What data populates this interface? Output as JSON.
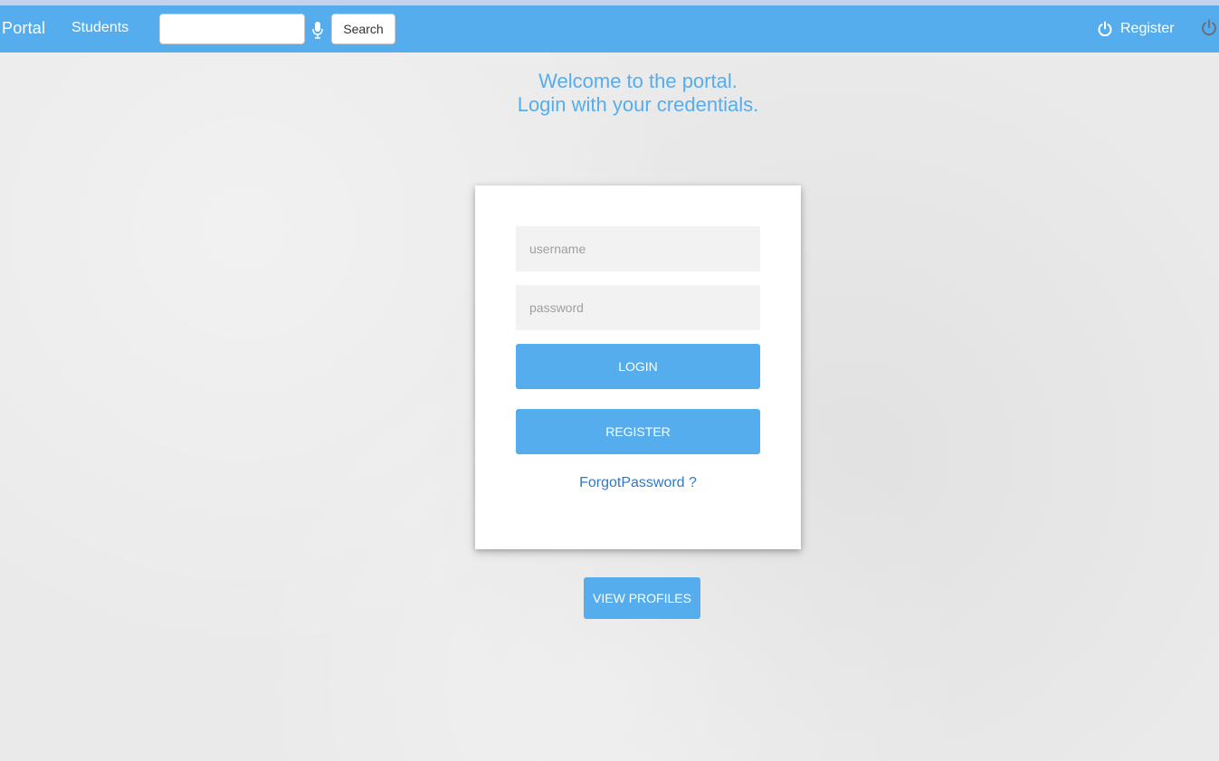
{
  "navbar": {
    "brand": "Portal",
    "students_link": "Students",
    "search": {
      "value": "",
      "placeholder": "",
      "button_label": "Search"
    },
    "register_link": "Register",
    "icons": {
      "mic": "microphone-icon",
      "power": "power-icon"
    },
    "color": "#55adee"
  },
  "welcome": {
    "line1": "Welcome to the portal.",
    "line2": "Login with your credentials."
  },
  "login_card": {
    "username_placeholder": "username",
    "password_placeholder": "password",
    "login_label": "LOGIN",
    "register_label": "REGISTER",
    "forgot_label": "ForgotPassword ?"
  },
  "view_profiles_label": "VIEW PROFILES",
  "colors": {
    "accent": "#55adee",
    "link": "#2f79c6",
    "field_bg": "#f2f2f2"
  }
}
